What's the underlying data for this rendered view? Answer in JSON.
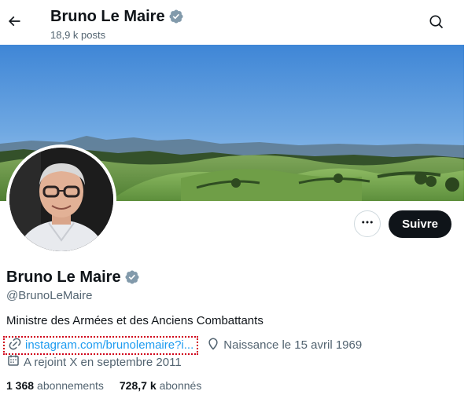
{
  "header": {
    "name": "Bruno Le Maire",
    "posts_count": "18,9 k posts"
  },
  "profile": {
    "name": "Bruno Le Maire",
    "handle": "@BrunoLeMaire",
    "bio": "Ministre des Armées et des Anciens Combattants",
    "link": "instagram.com/brunolemaire?i...",
    "birth": "Naissance le 15 avril 1969",
    "joined": "A rejoint X en septembre 2011",
    "verified": true
  },
  "actions": {
    "follow_label": "Suivre"
  },
  "stats": {
    "following_count": "1 368",
    "following_label": "abonnements",
    "followers_count": "728,7 k",
    "followers_label": "abonnés"
  },
  "icons": {
    "back": "arrow-left-icon",
    "search": "search-icon",
    "verified": "verified-badge-icon",
    "more": "more-icon",
    "link": "link-icon",
    "location": "location-pin-icon",
    "calendar": "calendar-icon"
  },
  "colors": {
    "accent": "#1d9bf0",
    "verified_badge": "#829aab",
    "text_primary": "#0f1419",
    "text_secondary": "#536471",
    "follow_button_bg": "#0f1419",
    "highlight_border": "#d0021b"
  }
}
